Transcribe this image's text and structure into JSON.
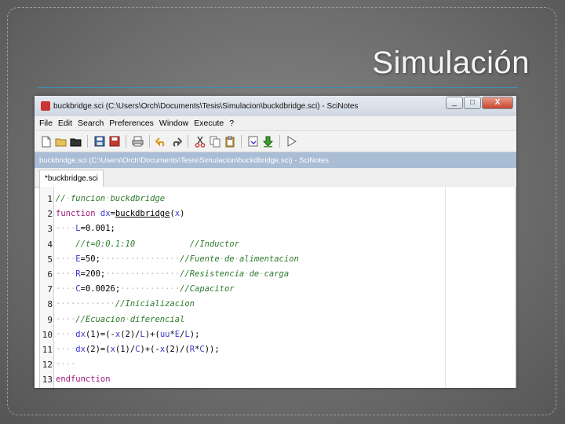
{
  "slide": {
    "title": "Simulación"
  },
  "window": {
    "title": "buckbridge.sci (C:\\Users\\Orch\\Documents\\Tesis\\Simulacion\\buckdbridge.sci) - SciNotes",
    "buttons": {
      "minimize": "_",
      "maximize": "□",
      "close": "X"
    }
  },
  "menu": [
    "File",
    "Edit",
    "Search",
    "Preferences",
    "Window",
    "Execute",
    "?"
  ],
  "toolbar_icons": [
    "new-file-icon",
    "open-folder-icon",
    "open-recent-icon",
    "save-icon",
    "save-as-icon",
    "print-icon",
    "undo-icon",
    "redo-icon",
    "cut-icon",
    "copy-icon",
    "paste-icon",
    "load-into-scilab-icon",
    "execute-save-icon",
    "run-icon"
  ],
  "docbar": "buckbridge.sci (C:\\Users\\Orch\\Documents\\Tesis\\Simulacion\\buckdbridge.sci) - SciNotes",
  "tab": {
    "label": "*buckbridge.sci"
  },
  "code_lines": [
    {
      "n": "1",
      "text": "//·funcion·buckdbridge"
    },
    {
      "n": "2",
      "text": "function dx=buckdbridge(x)"
    },
    {
      "n": "3",
      "text": "····L=0.001;"
    },
    {
      "n": "4",
      "text": "    //t=0:0.1:10           //Inductor"
    },
    {
      "n": "5",
      "text": "····E=50;················//Fuente·de·alimentacion"
    },
    {
      "n": "6",
      "text": "····R=200;···············//Resistencia·de·carga"
    },
    {
      "n": "7",
      "text": "····C=0.0026;············//Capacitor"
    },
    {
      "n": "8",
      "text": "············//Inicializacion"
    },
    {
      "n": "9",
      "text": "····//Ecuacion·diferencial"
    },
    {
      "n": "10",
      "text": "····dx(1)=(-x(2)/L)+(uu*E/L);"
    },
    {
      "n": "11",
      "text": "····dx(2)=(x(1)/C)+(-x(2)/(R*C));"
    },
    {
      "n": "12",
      "text": "····"
    },
    {
      "n": "13",
      "text": "endfunction"
    }
  ]
}
